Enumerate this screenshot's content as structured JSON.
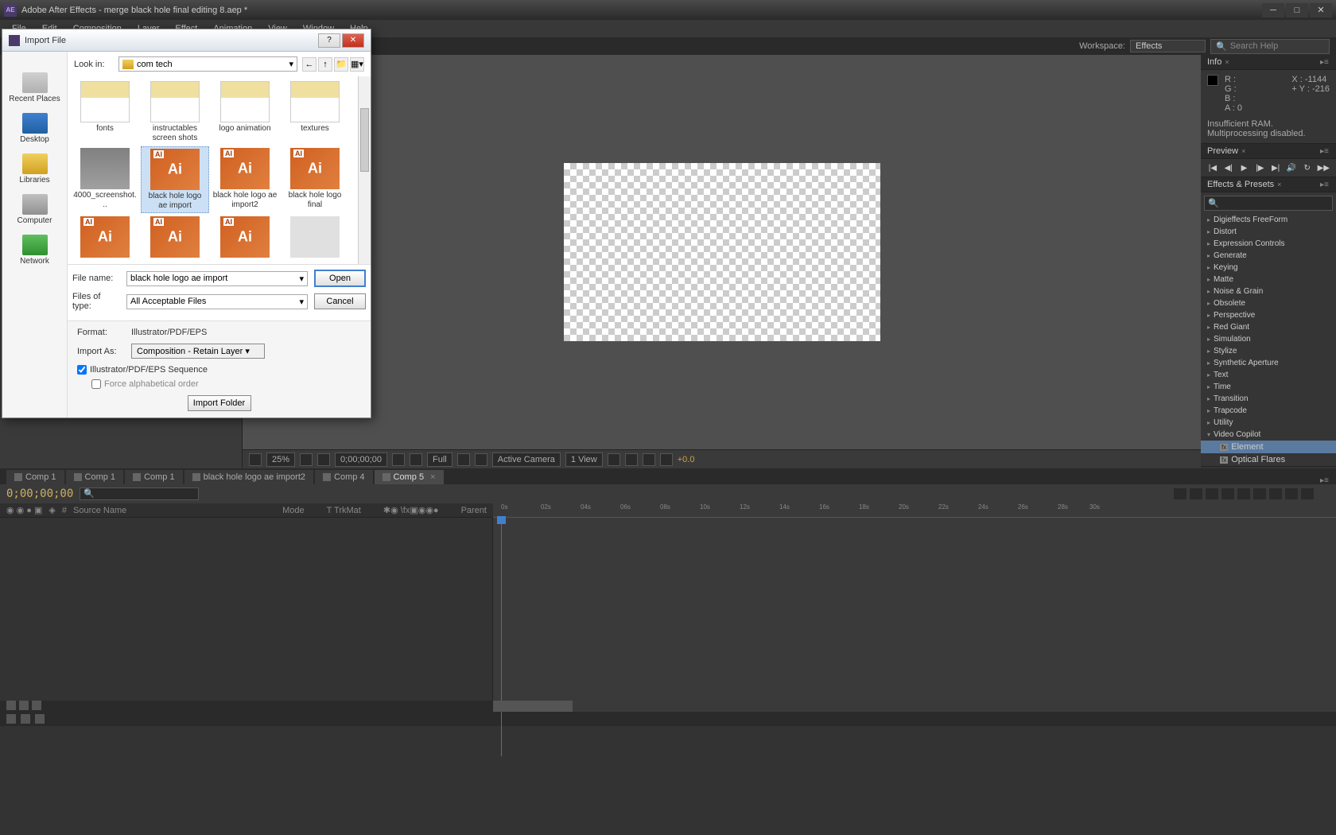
{
  "app": {
    "title": "Adobe After Effects - merge black hole final editing 8.aep *",
    "icon_text": "AE"
  },
  "menu": [
    "File",
    "Edit",
    "Composition",
    "Layer",
    "Effect",
    "Animation",
    "View",
    "Window",
    "Help"
  ],
  "workspace": {
    "label": "Workspace:",
    "value": "Effects",
    "search_placeholder": "Search Help"
  },
  "info_panel": {
    "title": "Info",
    "r": "R :",
    "g": "G :",
    "b": "B :",
    "a": "A : 0",
    "x": "X : -1144",
    "y": "Y : -216",
    "status1": "Insufficient RAM.",
    "status2": "Multiprocessing disabled."
  },
  "preview_panel": {
    "title": "Preview"
  },
  "effects_panel": {
    "title": "Effects & Presets",
    "categories": [
      "Digieffects FreeForm",
      "Distort",
      "Expression Controls",
      "Generate",
      "Keying",
      "Matte",
      "Noise & Grain",
      "Obsolete",
      "Perspective",
      "Red Giant",
      "Simulation",
      "Stylize",
      "Synthetic Aperture",
      "Text",
      "Time",
      "Transition",
      "Trapcode",
      "Utility"
    ],
    "expanded_cat": "Video Copilot",
    "sub_items": [
      "Element",
      "Optical Flares"
    ]
  },
  "viewer": {
    "zoom": "25%",
    "timecode": "0;00;00;00",
    "resolution": "Full",
    "camera": "Active Camera",
    "views": "1 View",
    "exposure": "+0.0"
  },
  "timeline": {
    "tabs": [
      "Comp 1",
      "Comp 1",
      "Comp 1",
      "black hole logo ae import2",
      "Comp 4",
      "Comp 5"
    ],
    "active_tab": 5,
    "timecode": "0;00;00;00",
    "columns": {
      "source": "Source Name",
      "mode": "Mode",
      "trkmat": "TrkMat",
      "parent": "Parent",
      "num": "#"
    },
    "ticks": [
      "0s",
      "02s",
      "04s",
      "06s",
      "08s",
      "10s",
      "12s",
      "14s",
      "16s",
      "18s",
      "20s",
      "22s",
      "24s",
      "26s",
      "28s",
      "30s"
    ]
  },
  "import_dialog": {
    "title": "Import File",
    "lookin_label": "Look in:",
    "lookin_value": "com tech",
    "sidebar": [
      "Recent Places",
      "Desktop",
      "Libraries",
      "Computer",
      "Network"
    ],
    "files_row1": [
      "fonts",
      "instructables screen shots",
      "logo animation",
      "textures"
    ],
    "files_row2": [
      "4000_screenshot...",
      "black hole logo ae import",
      "black hole logo ae import2",
      "black hole logo final"
    ],
    "selected_index": 1,
    "filename_label": "File name:",
    "filename_value": "black hole logo ae import",
    "filetype_label": "Files of type:",
    "filetype_value": "All Acceptable Files",
    "open_btn": "Open",
    "cancel_btn": "Cancel",
    "format_label": "Format:",
    "format_value": "Illustrator/PDF/EPS",
    "importas_label": "Import As:",
    "importas_value": "Composition - Retain Layer",
    "sequence_check": "Illustrator/PDF/EPS Sequence",
    "force_alpha": "Force alphabetical order",
    "import_folder": "Import Folder"
  }
}
